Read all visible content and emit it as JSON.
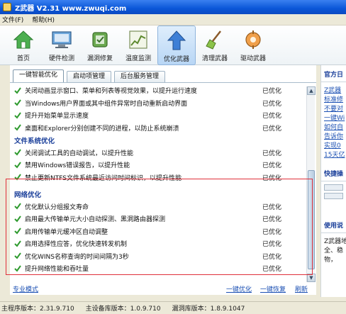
{
  "window": {
    "title": "Z武器 V2.31 www.zwuqi.com"
  },
  "menu": [
    "文件(F)",
    "帮助(H)"
  ],
  "toolbar": [
    {
      "label": "首页",
      "icon": "home-icon"
    },
    {
      "label": "硬件检测",
      "icon": "hardware-icon"
    },
    {
      "label": "漏洞修复",
      "icon": "patch-icon"
    },
    {
      "label": "温度监测",
      "icon": "temperature-chart-icon"
    },
    {
      "label": "优化武器",
      "icon": "upload-arrow-icon",
      "active": true
    },
    {
      "label": "清理武器",
      "icon": "broom-icon"
    },
    {
      "label": "驱动武器",
      "icon": "driver-icon"
    }
  ],
  "tabs": [
    "一键智能优化",
    "启动项管理",
    "后台服务管理"
  ],
  "list": {
    "items_top": [
      {
        "text": "关闭动画显示窗口、菜单和列表等视觉效果，以提升运行速度",
        "status": "已优化"
      },
      {
        "text": "当Windows用户界面或其中组件异常时自动重新启动界面",
        "status": "已优化"
      },
      {
        "text": "提升开始菜单显示速度",
        "status": "已优化"
      },
      {
        "text": "桌面和Explorer分别创建不同的进程，以防止系统崩溃",
        "status": "已优化"
      }
    ],
    "section_fs": "文件系统优化",
    "items_fs": [
      {
        "text": "关闭调试工具的自动调试，以提升性能",
        "status": "已优化"
      },
      {
        "text": "禁用Windows错误报告，以提升性能",
        "status": "已优化"
      },
      {
        "text": "禁止更新NTFS文件系统最近访问时间标识，以提升性能",
        "status": "已优化"
      }
    ],
    "section_net": "网络优化",
    "items_net": [
      {
        "text": "优化默认分组报文寿命",
        "status": "已优化"
      },
      {
        "text": "启用最大传输单元大小自动探测、黑洞路由器探测",
        "status": "已优化"
      },
      {
        "text": "启用传输单元缓冲区自动调整",
        "status": "已优化"
      },
      {
        "text": "启用选择性应答，优化快速转发机制",
        "status": "已优化"
      },
      {
        "text": "优化WINS名称查询的时间间隔为3秒",
        "status": "已优化"
      },
      {
        "text": "提升网络性能和吞吐量",
        "status": "已优化"
      }
    ]
  },
  "actions": {
    "professional_mode": "专业模式",
    "one_click_optimize": "一键优化",
    "one_click_restore": "一键恢复",
    "refresh": "刷新"
  },
  "right_panel": {
    "head1": "官方日",
    "links": [
      "Z武器",
      "标准修",
      "不要对",
      "一键Wi",
      "如何自",
      "告诉你",
      "实现0",
      "15天亿"
    ],
    "head2": "快捷操",
    "head3": "使用说",
    "text1": "Z武器地",
    "text2": "全、稳",
    "text3": "物，"
  },
  "status": {
    "main_version": "主程序版本：2.31.9.710",
    "device_db_version": "主设备库版本：1.0.9.710",
    "vuln_db_version": "漏洞库版本：1.8.9.1047"
  },
  "colors": {
    "accent_blue": "#1a4fb3",
    "section_blue": "#1a3f9a",
    "check_green": "#2e9a2e",
    "highlight_red": "#e0303a"
  }
}
